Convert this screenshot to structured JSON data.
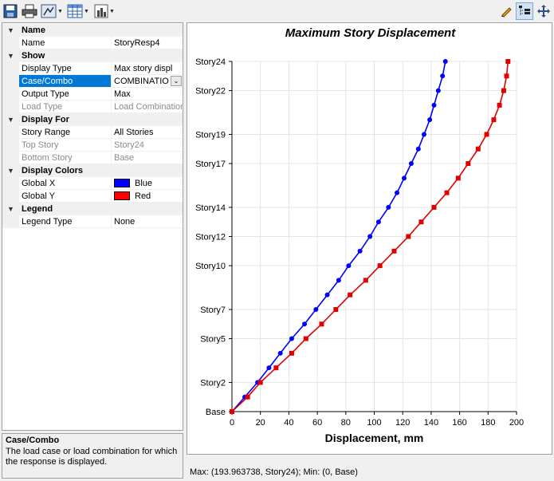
{
  "toolbar": {
    "left_icons": [
      "save-icon",
      "print-icon",
      "display-settings-icon",
      "table-icon",
      "chart-icon"
    ],
    "right_icons": [
      "pencil-icon",
      "tree-view-icon",
      "move-icon"
    ]
  },
  "property_grid": {
    "categories": [
      {
        "label": "Name",
        "rows": [
          {
            "name": "Name",
            "value": "StoryResp4"
          }
        ]
      },
      {
        "label": "Show",
        "rows": [
          {
            "name": "Display Type",
            "value": "Max story displ"
          },
          {
            "name": "Case/Combo",
            "value": "COMBINATIO",
            "selected": true
          },
          {
            "name": "Output Type",
            "value": "Max"
          },
          {
            "name": "Load Type",
            "value": "Load Combination",
            "disabled": true
          }
        ]
      },
      {
        "label": "Display For",
        "rows": [
          {
            "name": "Story Range",
            "value": "All Stories"
          },
          {
            "name": "Top Story",
            "value": "Story24",
            "disabled": true
          },
          {
            "name": "Bottom Story",
            "value": "Base",
            "disabled": true
          }
        ]
      },
      {
        "label": "Display Colors",
        "rows": [
          {
            "name": "Global X",
            "value": "Blue",
            "swatch": "#0000ff"
          },
          {
            "name": "Global Y",
            "value": "Red",
            "swatch": "#ff0000"
          }
        ]
      },
      {
        "label": "Legend",
        "rows": [
          {
            "name": "Legend Type",
            "value": "None"
          }
        ]
      }
    ]
  },
  "help": {
    "title": "Case/Combo",
    "description": "The load case or load combination for which the response is displayed."
  },
  "status_bar": {
    "text": "Max: (193.963738, Story24);   Min: (0, Base)"
  },
  "colors": {
    "series_x": "#0000ff",
    "series_y": "#e00000",
    "selection": "#0078d7"
  },
  "chart_data": {
    "type": "line",
    "title": "Maximum Story Displacement",
    "xlabel": "Displacement, mm",
    "ylabel": "",
    "xlim": [
      0,
      200
    ],
    "x_ticks": [
      0,
      20,
      40,
      60,
      80,
      100,
      120,
      140,
      160,
      180,
      200
    ],
    "y_tick_labels": [
      "Base",
      "Story2",
      "Story5",
      "Story7",
      "Story10",
      "Story12",
      "Story14",
      "Story17",
      "Story19",
      "Story22",
      "Story24"
    ],
    "y_tick_levels": [
      0,
      2,
      5,
      7,
      10,
      12,
      14,
      17,
      19,
      22,
      24
    ],
    "grid": true,
    "series": [
      {
        "color": "#0000ff",
        "marker": "circle",
        "levels": [
          0,
          1,
          2,
          3,
          4,
          5,
          6,
          7,
          8,
          9,
          10,
          11,
          12,
          13,
          14,
          15,
          16,
          17,
          18,
          19,
          20,
          21,
          22,
          23,
          24
        ],
        "values": [
          0,
          9,
          18,
          26,
          34,
          42,
          51,
          59,
          67,
          75,
          82,
          90,
          97,
          103,
          110,
          116,
          121,
          126,
          131,
          135,
          139,
          142,
          145,
          148,
          150
        ]
      },
      {
        "color": "#e00000",
        "marker": "square",
        "levels": [
          0,
          1,
          2,
          3,
          4,
          5,
          6,
          7,
          8,
          9,
          10,
          11,
          12,
          13,
          14,
          15,
          16,
          17,
          18,
          19,
          20,
          21,
          22,
          23,
          24
        ],
        "values": [
          0,
          11,
          20,
          31,
          42,
          52,
          63,
          73,
          83,
          94,
          104,
          114,
          124,
          133,
          142,
          151,
          159,
          166,
          173,
          179,
          184,
          188,
          191,
          193,
          194
        ]
      }
    ]
  }
}
